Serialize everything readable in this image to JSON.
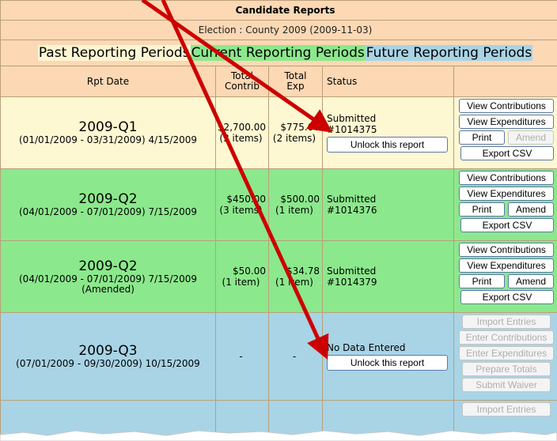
{
  "title": "Candidate Reports",
  "election": "Election : County 2009 (2009-11-03)",
  "periods": {
    "past": "Past Reporting Periods",
    "current": "Current Reporting Periods",
    "future": "Future Reporting Periods"
  },
  "columns": {
    "rpt_date": "Rpt Date",
    "total_contrib_1": "Total",
    "total_contrib_2": "Contrib",
    "total_exp_1": "Total",
    "total_exp_2": "Exp",
    "status": "Status"
  },
  "rows": [
    {
      "quarter": "2009-Q1",
      "range": "(01/01/2009 - 03/31/2009) 4/15/2009",
      "contrib": "$2,700.00",
      "contrib_items": "(3 items)",
      "exp": "$775.00",
      "exp_items": "(2 items)",
      "status": "Submitted",
      "status_id": "#1014375",
      "unlock_label": "Unlock this report",
      "actions": {
        "view_contrib": "View Contributions",
        "view_exp": "View Expenditures",
        "print": "Print",
        "amend": "Amend",
        "export": "Export CSV"
      }
    },
    {
      "quarter": "2009-Q2",
      "range": "(04/01/2009 - 07/01/2009) 7/15/2009",
      "contrib": "$450.00",
      "contrib_items": "(3 items)",
      "exp": "$500.00",
      "exp_items": "(1 item)",
      "status": "Submitted",
      "status_id": "#1014376",
      "actions": {
        "view_contrib": "View Contributions",
        "view_exp": "View Expenditures",
        "print": "Print",
        "amend": "Amend",
        "export": "Export CSV"
      }
    },
    {
      "quarter": "2009-Q2",
      "range": "(04/01/2009 - 07/01/2009) 7/15/2009",
      "note": "(Amended)",
      "contrib": "$50.00",
      "contrib_items": "(1 item)",
      "exp": "$34.78",
      "exp_items": "(1 item)",
      "status": "Submitted",
      "status_id": "#1014379",
      "actions": {
        "view_contrib": "View Contributions",
        "view_exp": "View Expenditures",
        "print": "Print",
        "amend": "Amend",
        "export": "Export CSV"
      }
    },
    {
      "quarter": "2009-Q3",
      "range": "(07/01/2009 - 09/30/2009) 10/15/2009",
      "contrib": "-",
      "exp": "-",
      "status": "No Data Entered",
      "unlock_label": "Unlock this report",
      "actions": {
        "import": "Import Entries",
        "enter_contrib": "Enter Contributions",
        "enter_exp": "Enter Expenditures",
        "prepare": "Prepare Totals",
        "waiver": "Submit Waiver"
      }
    },
    {
      "actions": {
        "import": "Import Entries"
      }
    }
  ],
  "colors": {
    "header": "#fcd8b4",
    "past": "#fdf7d2",
    "current": "#8ce88c",
    "future": "#a8d4e6",
    "arrow": "#cc0000"
  }
}
